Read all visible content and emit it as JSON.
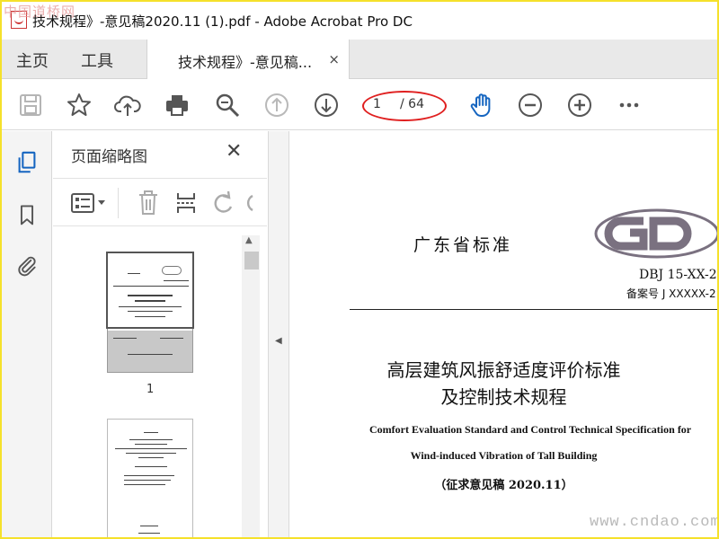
{
  "window": {
    "title": "技术规程》-意见稿2020.11 (1).pdf - Adobe Acrobat Pro DC",
    "watermark_top": "中国道桥网",
    "watermark_bottom": "www.cndao.com"
  },
  "tabs": {
    "home": "主页",
    "tools": "工具",
    "document": "技术规程》-意见稿...",
    "close": "×"
  },
  "toolbar": {
    "current_page": "1",
    "total_pages": "/ 64",
    "icons": [
      "save-icon",
      "star-icon",
      "cloud-upload-icon",
      "print-icon",
      "zoom-search-icon",
      "page-up-icon",
      "page-down-icon",
      "hand-icon",
      "zoom-out-icon",
      "zoom-in-icon",
      "more-icon"
    ]
  },
  "panel": {
    "title": "页面缩略图",
    "close": "✕",
    "thumbnail_1_label": "1"
  },
  "document": {
    "standard_org": "广东省标准",
    "standard_no": "DBJ 15-XX-2",
    "registration": "备案号 J XXXXX-2",
    "title_line1": "高层建筑风振舒适度评价标准",
    "title_line2": "及控制技术规程",
    "english_line1": "Comfort Evaluation Standard and Control Technical Specification for",
    "english_line2": "Wind-induced Vibration of Tall Building",
    "draft_note": "（征求意见稿 2020.11）"
  },
  "colors": {
    "accent_blue": "#1565c0",
    "highlight_red": "#e02020",
    "frame_yellow": "#f5e12b"
  }
}
